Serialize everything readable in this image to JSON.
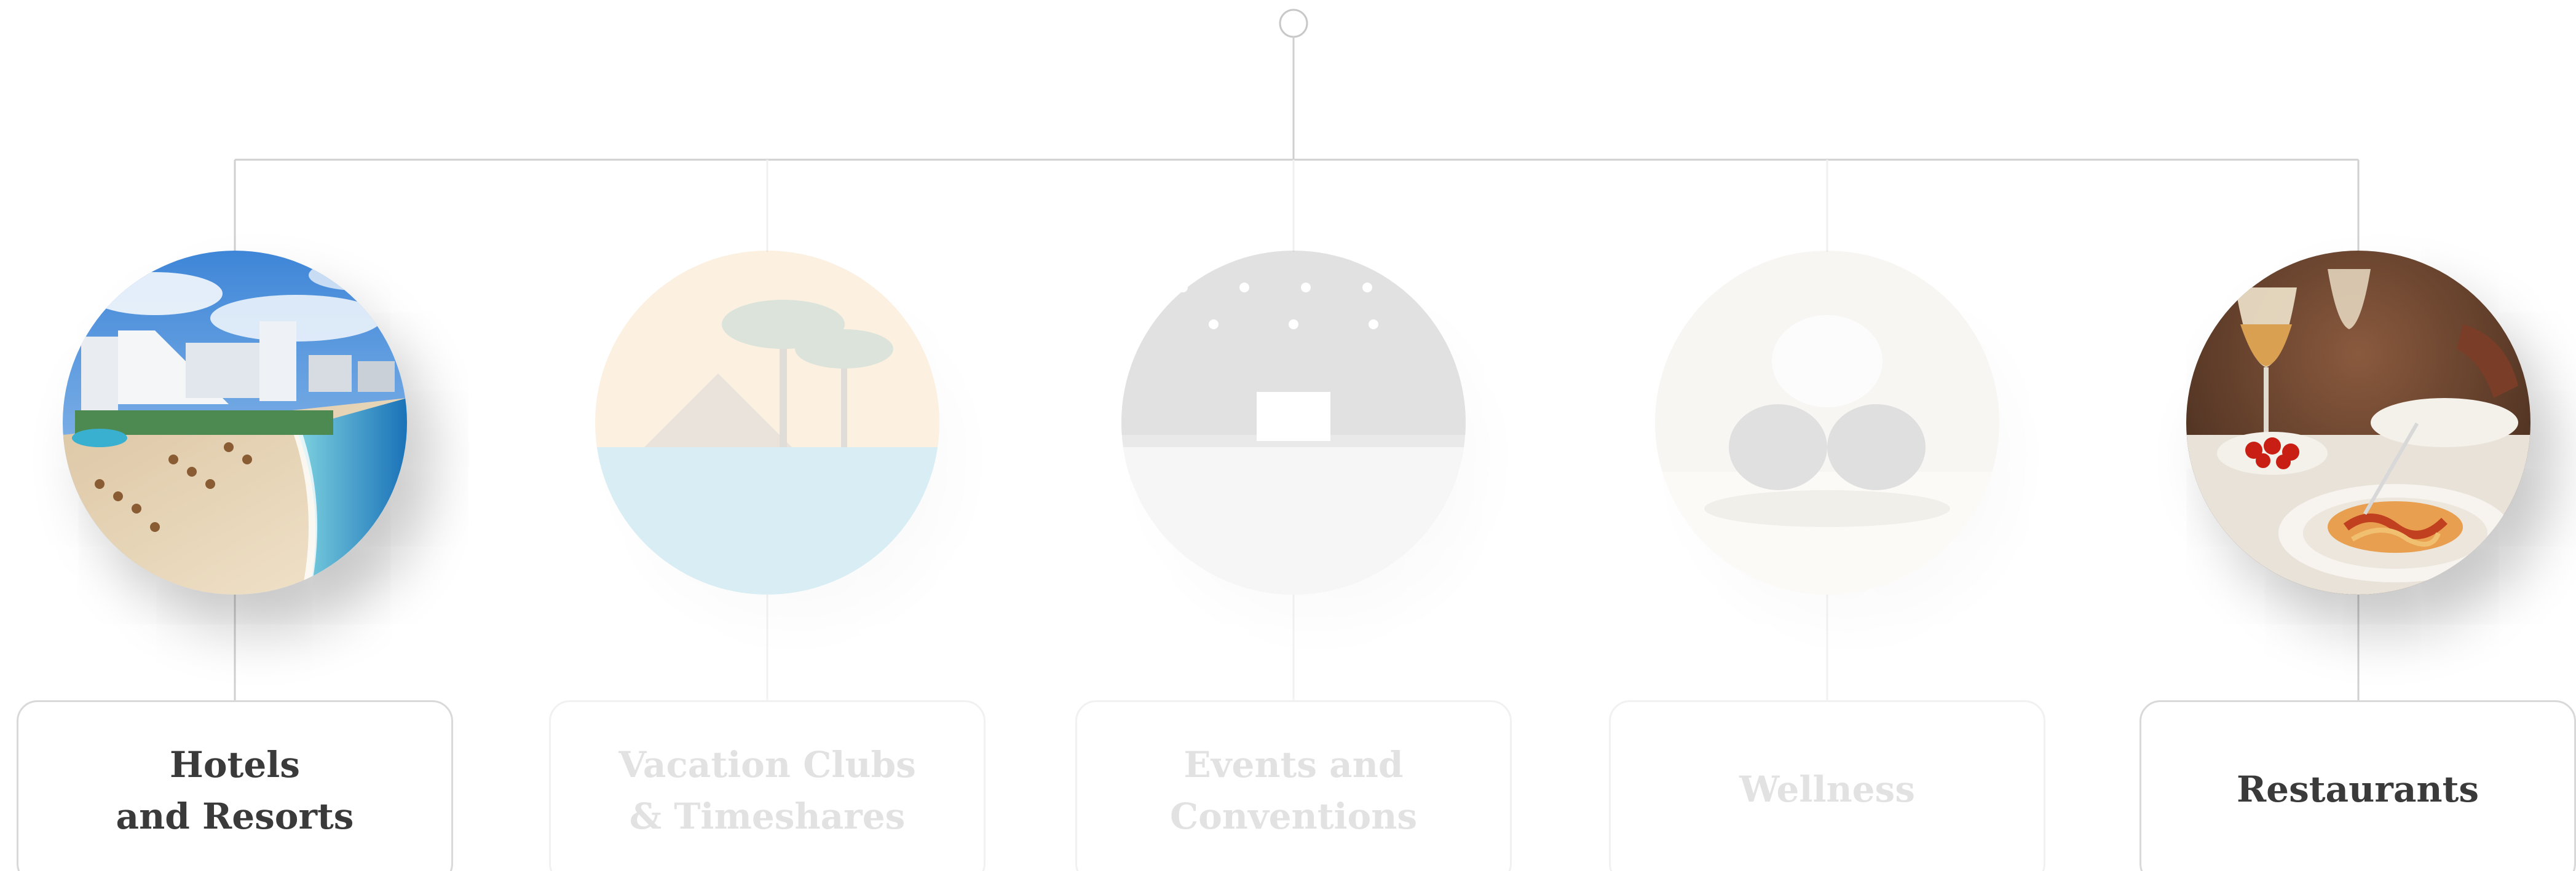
{
  "categories": [
    {
      "id": "hotels",
      "label": "Hotels\nand Resorts",
      "active": true,
      "image": "beach-resort-photo"
    },
    {
      "id": "vacation",
      "label": "Vacation Clubs\n& Timeshares",
      "active": false,
      "image": "palm-pool-photo"
    },
    {
      "id": "events",
      "label": "Events and\nConventions",
      "active": false,
      "image": "ballroom-photo"
    },
    {
      "id": "wellness",
      "label": "Wellness",
      "active": false,
      "image": "spa-towels-photo"
    },
    {
      "id": "restaurants",
      "label": "Restaurants",
      "active": true,
      "image": "pasta-dinner-photo"
    }
  ],
  "colors": {
    "line": "#d0d0d0",
    "line_faded": "#efefef",
    "text_active": "#3a3a3a",
    "text_faded": "#e2e2e2"
  }
}
